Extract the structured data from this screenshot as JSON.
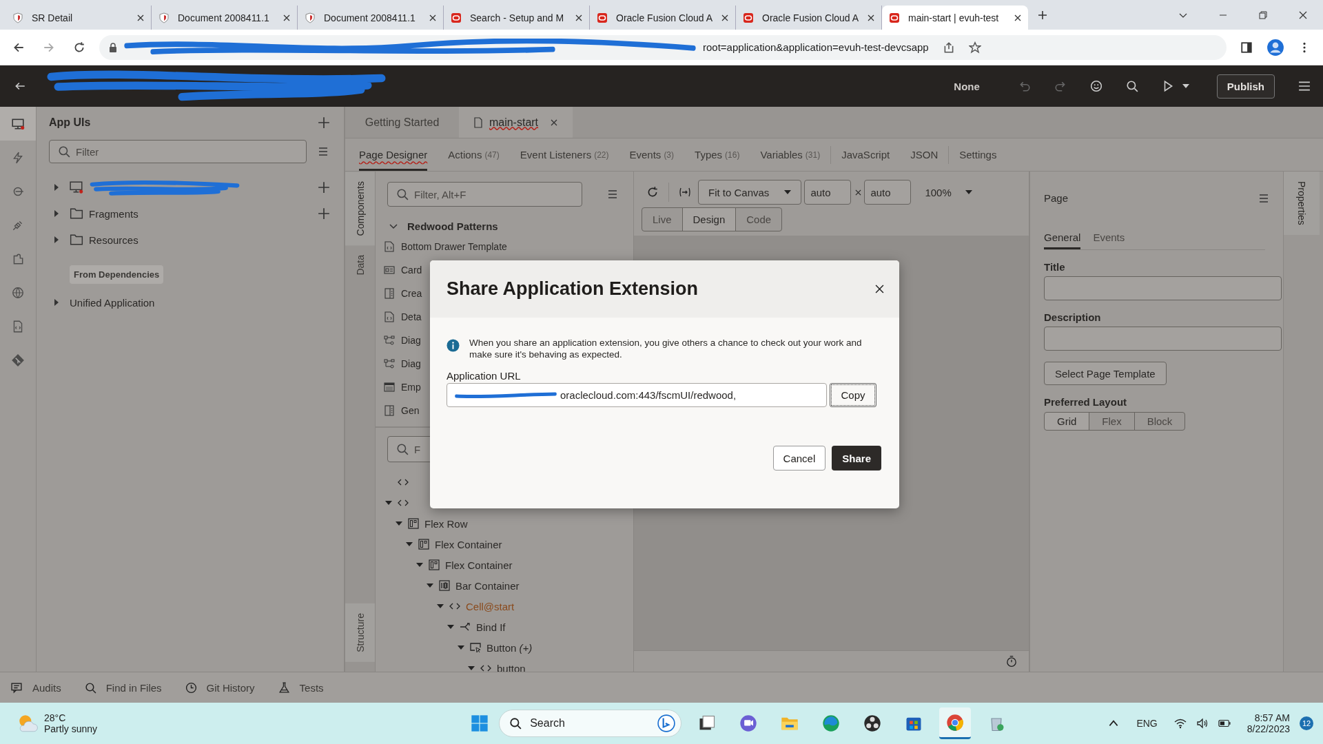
{
  "browser": {
    "tabs": [
      {
        "title": "SR Detail",
        "kind": "shield",
        "selected": false
      },
      {
        "title": "Document 2008411.1",
        "kind": "shield",
        "selected": false
      },
      {
        "title": "Document 2008411.1",
        "kind": "shield",
        "selected": false
      },
      {
        "title": "Search - Setup and M",
        "kind": "oracle",
        "selected": false
      },
      {
        "title": "Oracle Fusion Cloud A",
        "kind": "oracle",
        "selected": false
      },
      {
        "title": "Oracle Fusion Cloud A",
        "kind": "oracle",
        "selected": false
      },
      {
        "title": "main-start | evuh-test",
        "kind": "oracle",
        "selected": true
      }
    ],
    "address": "root=application&application=evuh-test-devcsapp"
  },
  "header": {
    "mode": "None",
    "publish": "Publish"
  },
  "rail": [
    {
      "kind": "monitor",
      "selected": true
    },
    {
      "kind": "bolt",
      "selected": false
    },
    {
      "kind": "ring",
      "selected": false
    },
    {
      "kind": "plug",
      "selected": false
    },
    {
      "kind": "puzzle",
      "selected": false
    },
    {
      "kind": "globe",
      "selected": false
    },
    {
      "kind": "file",
      "selected": false
    },
    {
      "kind": "git",
      "selected": false
    }
  ],
  "left_panel": {
    "title": "App UIs",
    "filter_placeholder": "Filter",
    "items": [
      {
        "kind": "app",
        "redacted": true,
        "add": true
      },
      {
        "kind": "folder",
        "label": "Fragments",
        "add": true
      },
      {
        "kind": "folder",
        "label": "Resources"
      }
    ],
    "dependencies_label": "From Dependencies",
    "dependencies": [
      {
        "label": "Unified Application"
      }
    ]
  },
  "editor": {
    "tabs": [
      {
        "label": "Getting Started",
        "selected": false,
        "closable": false
      },
      {
        "label": "main-start",
        "selected": true,
        "closable": true
      }
    ],
    "subtabs": [
      {
        "label": "Page Designer",
        "selected": true
      },
      {
        "label": "Actions",
        "count": "(47)",
        "selected": false
      },
      {
        "label": "Event Listeners",
        "count": "(22)",
        "selected": false
      },
      {
        "label": "Events",
        "count": "(3)",
        "selected": false
      },
      {
        "label": "Types",
        "count": "(16)",
        "selected": false
      },
      {
        "label": "Variables",
        "count": "(31)",
        "selected": false
      },
      {
        "label": "JavaScript",
        "selected": false
      },
      {
        "label": "JSON",
        "selected": false
      },
      {
        "label": "Settings",
        "selected": false
      }
    ]
  },
  "components": {
    "side_tabs": [
      {
        "label": "Components",
        "selected": true
      },
      {
        "label": "Data",
        "selected": false
      }
    ],
    "structure_tab": "Structure",
    "filter_placeholder": "Filter, Alt+F",
    "group": "Redwood Patterns",
    "group_expanded": true,
    "items": [
      {
        "label": "Bottom Drawer Template",
        "kind": "template"
      },
      {
        "label": "Card",
        "kind": "card"
      },
      {
        "label": "Crea",
        "kind": "split"
      },
      {
        "label": "Deta",
        "kind": "template"
      },
      {
        "label": "Diag",
        "kind": "diagram"
      },
      {
        "label": "Diag",
        "kind": "diagram"
      },
      {
        "label": "Emp",
        "kind": "table"
      },
      {
        "label": "Gen",
        "kind": "split"
      }
    ],
    "structure_filter_placeholder": "F",
    "tree": [
      {
        "kind": "code"
      },
      {
        "kind": "code",
        "expanded": true,
        "children": [
          {
            "kind": "flex",
            "label": "Flex Row",
            "expanded": true,
            "children": [
              {
                "kind": "flex",
                "label": "Flex Container",
                "expanded": true,
                "children": [
                  {
                    "kind": "flex",
                    "label": "Flex Container",
                    "expanded": true,
                    "children": [
                      {
                        "kind": "bar",
                        "label": "Bar Container",
                        "expanded": true,
                        "children": [
                          {
                            "kind": "slot",
                            "label": "Cell@start",
                            "expanded": true,
                            "children": [
                              {
                                "kind": "bind",
                                "label": "Bind If",
                                "expanded": true,
                                "children": [
                                  {
                                    "kind": "button",
                                    "label": "Button *(+)*",
                                    "expanded": true,
                                    "children": [
                                      {
                                        "kind": "code",
                                        "label": "button",
                                        "expanded": true
                                      }
                                    ]
                                  }
                                ]
                              }
                            ]
                          }
                        ]
                      }
                    ]
                  }
                ]
              }
            ]
          }
        ]
      }
    ]
  },
  "canvas": {
    "fit": "Fit to Canvas",
    "width": "auto",
    "height": "auto",
    "zoom": "100%",
    "modes": [
      {
        "label": "Live",
        "selected": false
      },
      {
        "label": "Design",
        "selected": true
      },
      {
        "label": "Code",
        "selected": false
      }
    ]
  },
  "properties": {
    "title": "Page",
    "tabs": [
      {
        "label": "General",
        "selected": true
      },
      {
        "label": "Events",
        "selected": false
      }
    ],
    "fields": [
      {
        "label": "Title"
      },
      {
        "label": "Description"
      }
    ],
    "template_button": "Select Page Template",
    "layout_label": "Preferred Layout",
    "layouts": [
      {
        "label": "Grid",
        "selected": true
      },
      {
        "label": "Flex",
        "selected": false
      },
      {
        "label": "Block",
        "selected": false
      }
    ],
    "side_tab": "Properties"
  },
  "bottom_bar": [
    {
      "label": "Audits",
      "kind": "audits"
    },
    {
      "label": "Find in Files",
      "kind": "search"
    },
    {
      "label": "Git History",
      "kind": "clock"
    },
    {
      "label": "Tests",
      "kind": "flask"
    }
  ],
  "dialog": {
    "title": "Share Application Extension",
    "info": "When you share an application extension, you give others a chance to check out your work and make sure it's behaving as expected.",
    "url_label": "Application URL",
    "url_value": "oraclecloud.com:443/fscmUI/redwood,",
    "copy": "Copy",
    "cancel": "Cancel",
    "share": "Share"
  },
  "taskbar": {
    "temp": "28°C",
    "weather": "Partly sunny",
    "search": "Search",
    "apps": [
      {
        "kind": "files",
        "selected": false
      },
      {
        "kind": "chat",
        "selected": false
      },
      {
        "kind": "folder",
        "selected": false
      },
      {
        "kind": "edge",
        "selected": false
      },
      {
        "kind": "obs",
        "selected": false
      },
      {
        "kind": "store",
        "selected": false
      },
      {
        "kind": "chrome",
        "selected": true
      },
      {
        "kind": "bin",
        "selected": false
      }
    ],
    "lang": "ENG",
    "time": "8:57 AM",
    "date": "8/22/2023",
    "badge": "12"
  }
}
